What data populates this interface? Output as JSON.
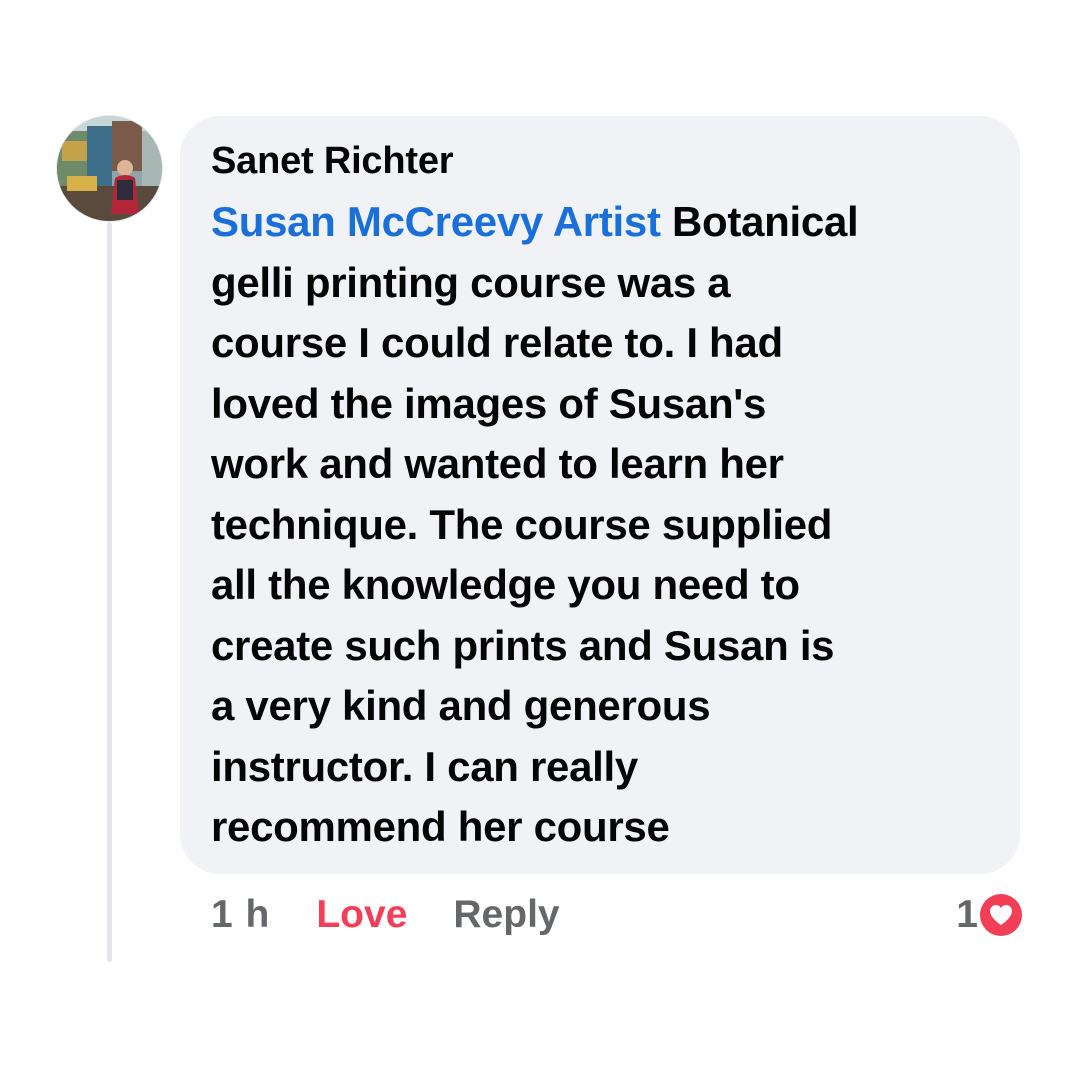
{
  "comment": {
    "author": "Sanet Richter",
    "mention": "Susan McCreevy Artist",
    "lines": [
      " Botanical",
      "gelli printing course was a",
      "course I could relate to. I had",
      "loved the images of Susan's",
      "work and wanted to learn her",
      "technique. The course supplied",
      "all the knowledge you need to",
      "create such prints and Susan is",
      "a very kind and generous",
      "instructor. I can really",
      "recommend her course"
    ]
  },
  "actions": {
    "time": "1 h",
    "love_label": "Love",
    "reply_label": "Reply"
  },
  "reactions": {
    "count": "1",
    "type_icon": "heart-icon"
  },
  "colors": {
    "mention": "#1a6fd8",
    "love": "#f33e58",
    "muted": "#65676b",
    "bubble": "#f0f2f5"
  }
}
